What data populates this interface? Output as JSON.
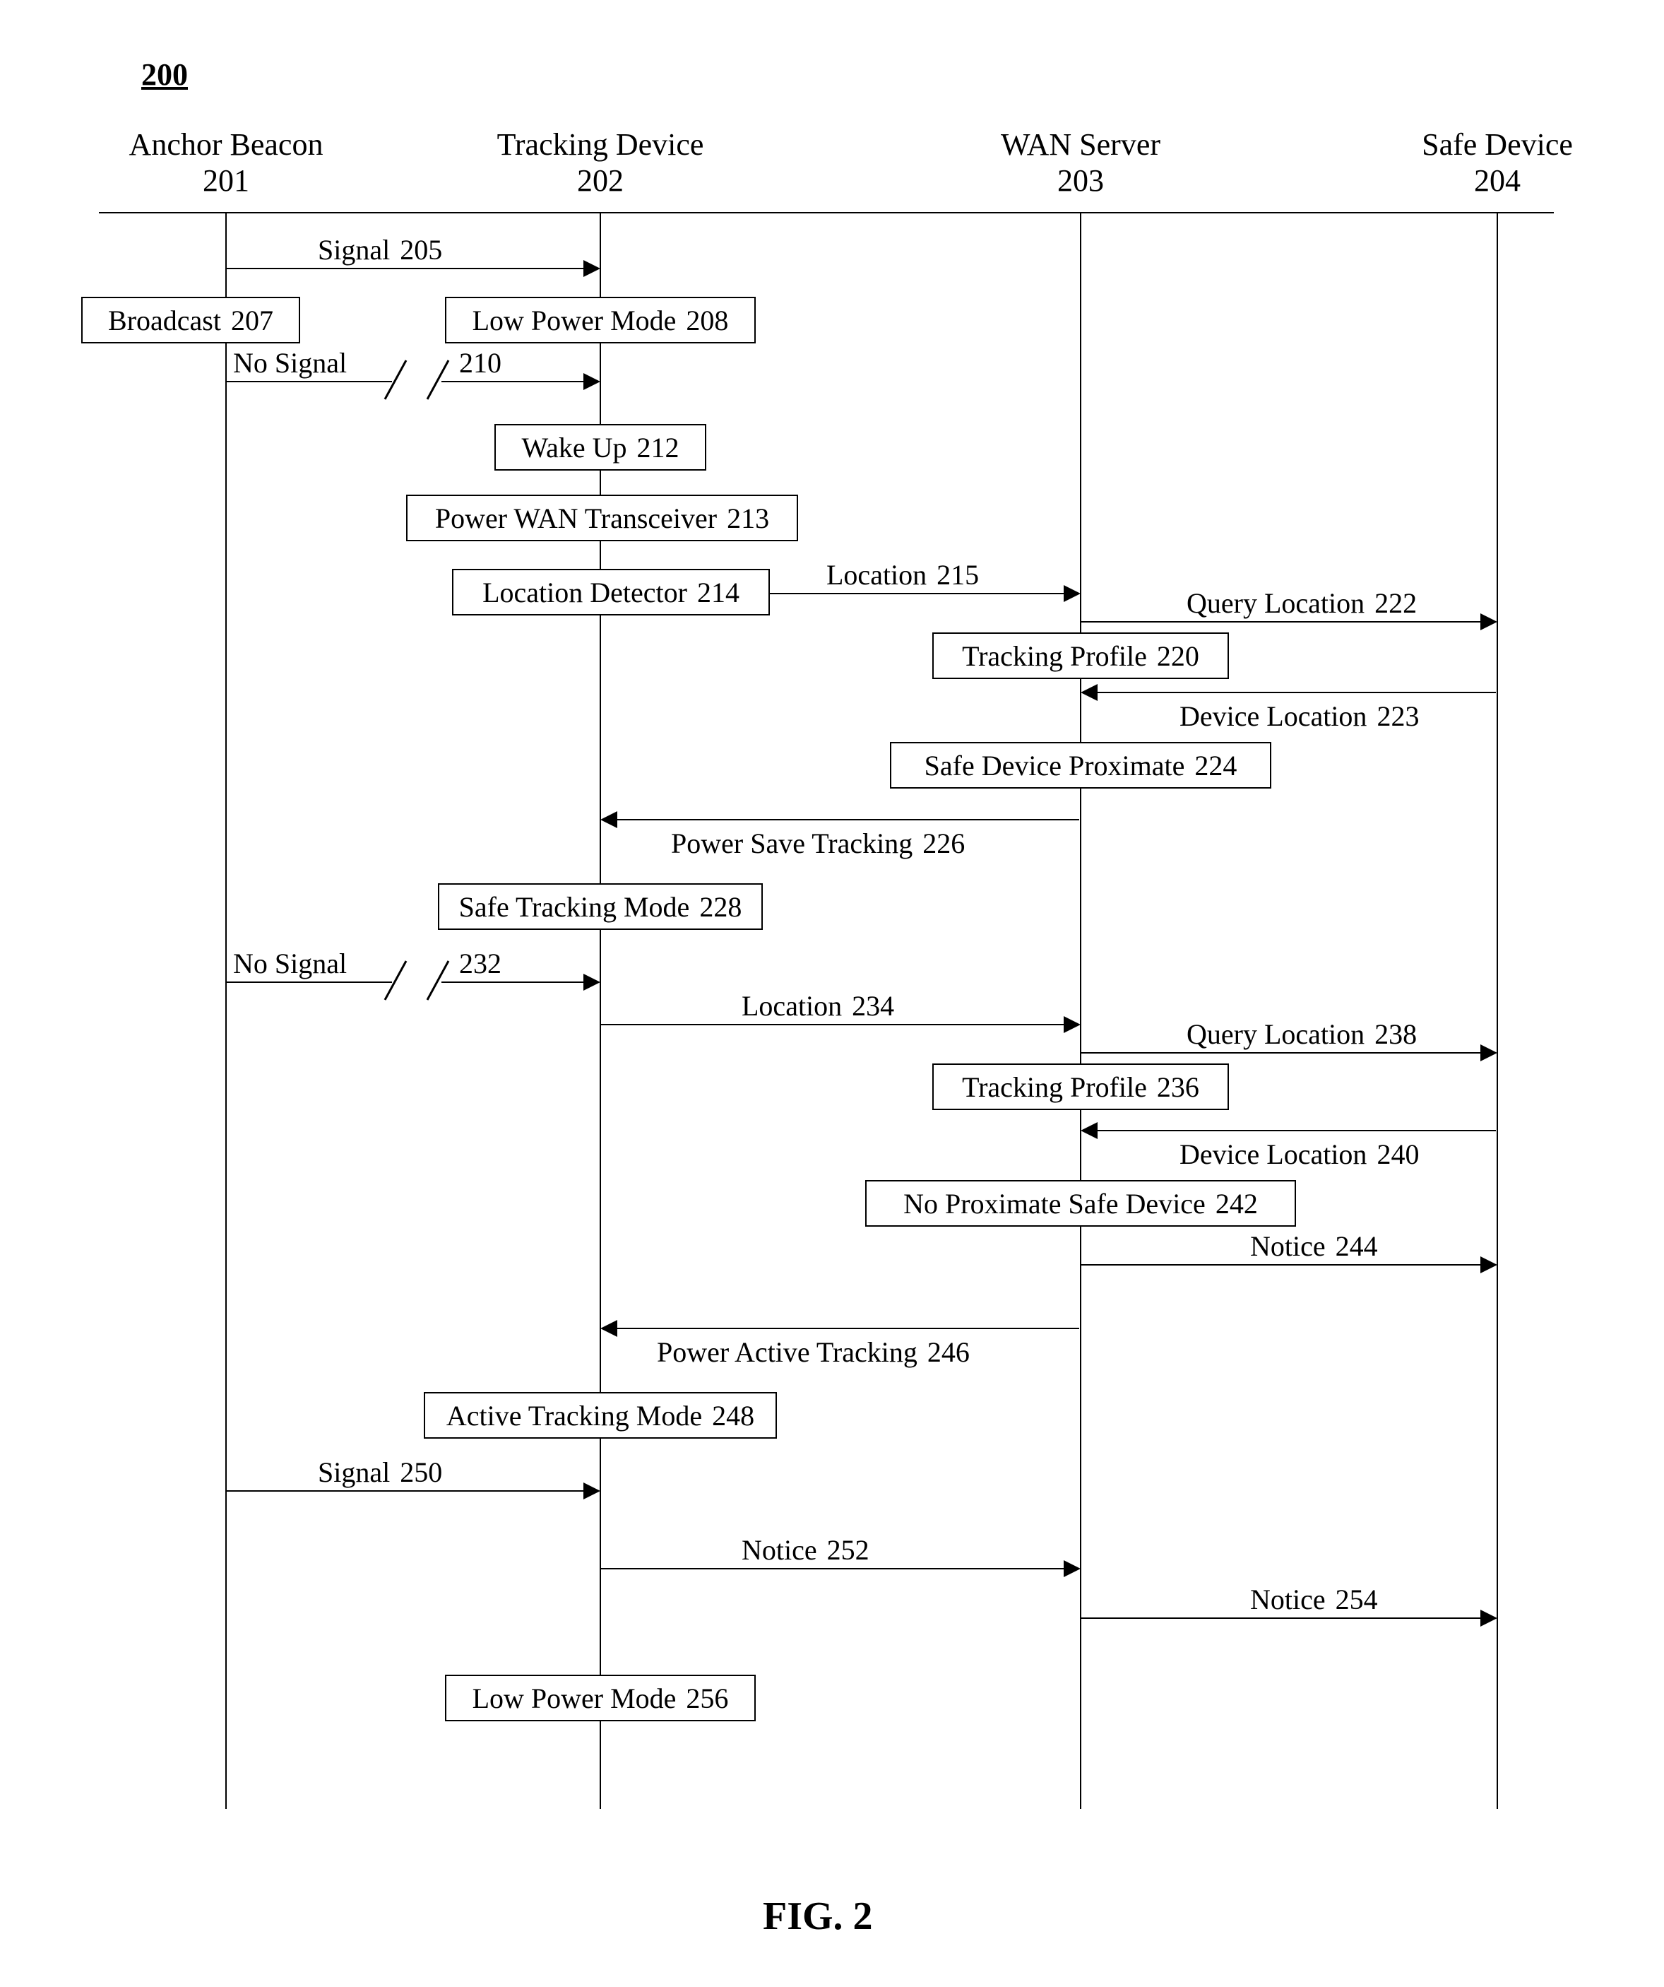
{
  "figure_number": "200",
  "figure_caption": "FIG. 2",
  "lanes": {
    "anchor": {
      "title": "Anchor Beacon",
      "id": "201"
    },
    "tracking": {
      "title": "Tracking Device",
      "id": "202"
    },
    "wan": {
      "title": "WAN Server",
      "id": "203"
    },
    "safe": {
      "title": "Safe Device",
      "id": "204"
    }
  },
  "messages": {
    "m205": {
      "text": "Signal",
      "num": "205"
    },
    "m210": {
      "text": "No Signal",
      "num": "210"
    },
    "m215": {
      "text": "Location",
      "num": "215"
    },
    "m222": {
      "text": "Query Location",
      "num": "222"
    },
    "m223": {
      "text": "Device Location",
      "num": "223"
    },
    "m226": {
      "text": "Power Save Tracking",
      "num": "226"
    },
    "m232": {
      "text": "No Signal",
      "num": "232"
    },
    "m234": {
      "text": "Location",
      "num": "234"
    },
    "m238": {
      "text": "Query Location",
      "num": "238"
    },
    "m240": {
      "text": "Device Location",
      "num": "240"
    },
    "m244": {
      "text": "Notice",
      "num": "244"
    },
    "m246": {
      "text": "Power Active Tracking",
      "num": "246"
    },
    "m250": {
      "text": "Signal",
      "num": "250"
    },
    "m252": {
      "text": "Notice",
      "num": "252"
    },
    "m254": {
      "text": "Notice",
      "num": "254"
    }
  },
  "boxes": {
    "b207": {
      "text": "Broadcast",
      "num": "207"
    },
    "b208": {
      "text": "Low Power Mode",
      "num": "208"
    },
    "b212": {
      "text": "Wake Up",
      "num": "212"
    },
    "b213": {
      "text": "Power WAN Transceiver",
      "num": "213"
    },
    "b214": {
      "text": "Location Detector",
      "num": "214"
    },
    "b220": {
      "text": "Tracking Profile",
      "num": "220"
    },
    "b224": {
      "text": "Safe Device Proximate",
      "num": "224"
    },
    "b228": {
      "text": "Safe Tracking Mode",
      "num": "228"
    },
    "b236": {
      "text": "Tracking Profile",
      "num": "236"
    },
    "b242": {
      "text": "No Proximate Safe Device",
      "num": "242"
    },
    "b248": {
      "text": "Active Tracking Mode",
      "num": "248"
    },
    "b256": {
      "text": "Low Power Mode",
      "num": "256"
    }
  }
}
